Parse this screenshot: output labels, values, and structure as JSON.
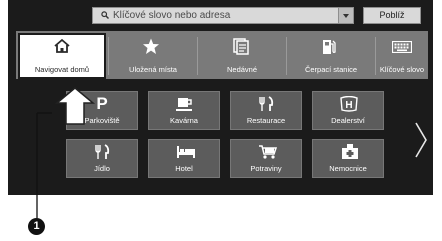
{
  "search": {
    "text": "Klíčové slovo nebo adresa",
    "nearby_label": "Poblíž"
  },
  "top_categories": [
    {
      "label": "Navigovat domů",
      "icon": "home-icon",
      "selected": true
    },
    {
      "label": "Uložená místa",
      "icon": "star-icon"
    },
    {
      "label": "Nedávné",
      "icon": "recent-icon"
    },
    {
      "label": "Čerpací stanice",
      "icon": "fuel-icon"
    },
    {
      "label": "Klíčové slovo",
      "icon": "keyboard-icon"
    }
  ],
  "grid": [
    {
      "label": "Parkoviště",
      "icon": "parking-icon",
      "glyph": "P"
    },
    {
      "label": "Kavárna",
      "icon": "coffee-icon"
    },
    {
      "label": "Restaurace",
      "icon": "restaurant-icon"
    },
    {
      "label": "Dealerství",
      "icon": "honda-logo-icon",
      "glyph": "H"
    },
    {
      "label": "Jídlo",
      "icon": "food-icon"
    },
    {
      "label": "Hotel",
      "icon": "hotel-icon"
    },
    {
      "label": "Potraviny",
      "icon": "grocery-cart-icon"
    },
    {
      "label": "Nemocnice",
      "icon": "hospital-icon"
    }
  ],
  "pager": {
    "pages": 2,
    "current": 1
  },
  "callout": {
    "number": "1"
  },
  "colors": {
    "screen_bg": "#1b1b1b",
    "topbar_bg": "#7a7a7a",
    "tile_bg": "#5c5c5c",
    "selected_bg": "#ffffff"
  }
}
